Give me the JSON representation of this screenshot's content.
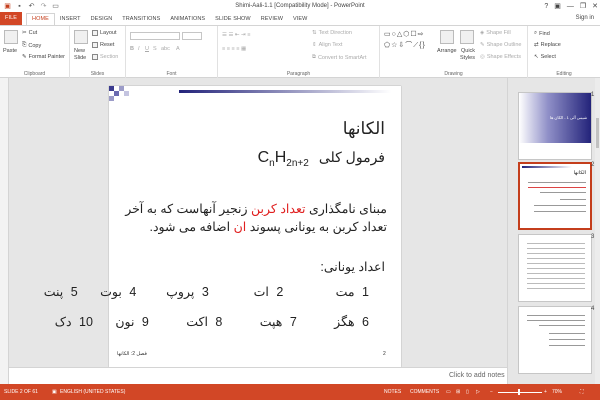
{
  "window": {
    "title": "Shimi-Aali-1.1 [Compatibility Mode] - PowerPoint",
    "controls": [
      "?",
      "▣",
      "—",
      "❐",
      "✕"
    ]
  },
  "qat": {
    "save_icon": "save-icon",
    "undo_icon": "undo-icon",
    "redo_icon": "redo-icon",
    "present_icon": "start-slideshow-icon"
  },
  "tabs": [
    "FILE",
    "HOME",
    "INSERT",
    "DESIGN",
    "TRANSITIONS",
    "ANIMATIONS",
    "SLIDE SHOW",
    "REVIEW",
    "VIEW"
  ],
  "active_tab": "HOME",
  "account": {
    "sign_in": "Sign in"
  },
  "ribbon": {
    "clipboard": {
      "paste": "Paste",
      "cut": "Cut",
      "copy": "Copy",
      "format_painter": "Format Painter",
      "label": "Clipboard"
    },
    "slides": {
      "new_slide": "New",
      "new_slide_2": "Slide",
      "layout": "Layout",
      "reset": "Reset",
      "section": "Section",
      "label": "Slides"
    },
    "font": {
      "label": "Font"
    },
    "paragraph": {
      "text_direction": "Text Direction",
      "align_text": "Align Text",
      "convert_smartart": "Convert to SmartArt",
      "label": "Paragraph"
    },
    "drawing": {
      "arrange": "Arrange",
      "quick_styles": "Quick",
      "quick_styles_2": "Styles",
      "shape_fill": "Shape Fill",
      "shape_outline": "Shape Outline",
      "shape_effects": "Shape Effects",
      "label": "Drawing"
    },
    "editing": {
      "find": "Find",
      "replace": "Replace",
      "select": "Select",
      "label": "Editing"
    }
  },
  "slide": {
    "title": "الکانها",
    "formula_label": "فرمول کلی",
    "formula": {
      "c": "C",
      "n": "n",
      "h": "H",
      "sub2": "2n+2"
    },
    "para_part1": "مبنای نامگذاری",
    "para_red1": "تعداد کربن",
    "para_part2": "زنجیر آنهاست که به آخر تعداد کربن به یونانی پسوند",
    "para_red2": "ان",
    "para_part3": "اضافه می شود.",
    "numbers_heading": "اعداد یونانی:",
    "row1": "1 مت       2 ات      3 پروپ    4 بوت   5 پنت",
    "row2": "6 هگز     7 هپت     8 اکت     9 نون   10 دک",
    "footer_left": "فصل 2: الکانها",
    "footer_num": "2"
  },
  "notes": {
    "placeholder": "Click to add notes"
  },
  "thumbnails": [
    {
      "num": "1",
      "caption": "شیمی آلی 1 - الکان ها"
    },
    {
      "num": "2",
      "caption": "الکانها"
    },
    {
      "num": "3",
      "caption": ""
    },
    {
      "num": "4",
      "caption": ""
    }
  ],
  "status": {
    "slide_info": "SLIDE 2 OF 61",
    "language": "ENGLISH (UNITED STATES)",
    "notes": "NOTES",
    "comments": "COMMENTS",
    "zoom": "70%"
  },
  "colors": {
    "accent": "#d24726",
    "slide_deco": "#23237a",
    "red_text": "#e02020"
  }
}
